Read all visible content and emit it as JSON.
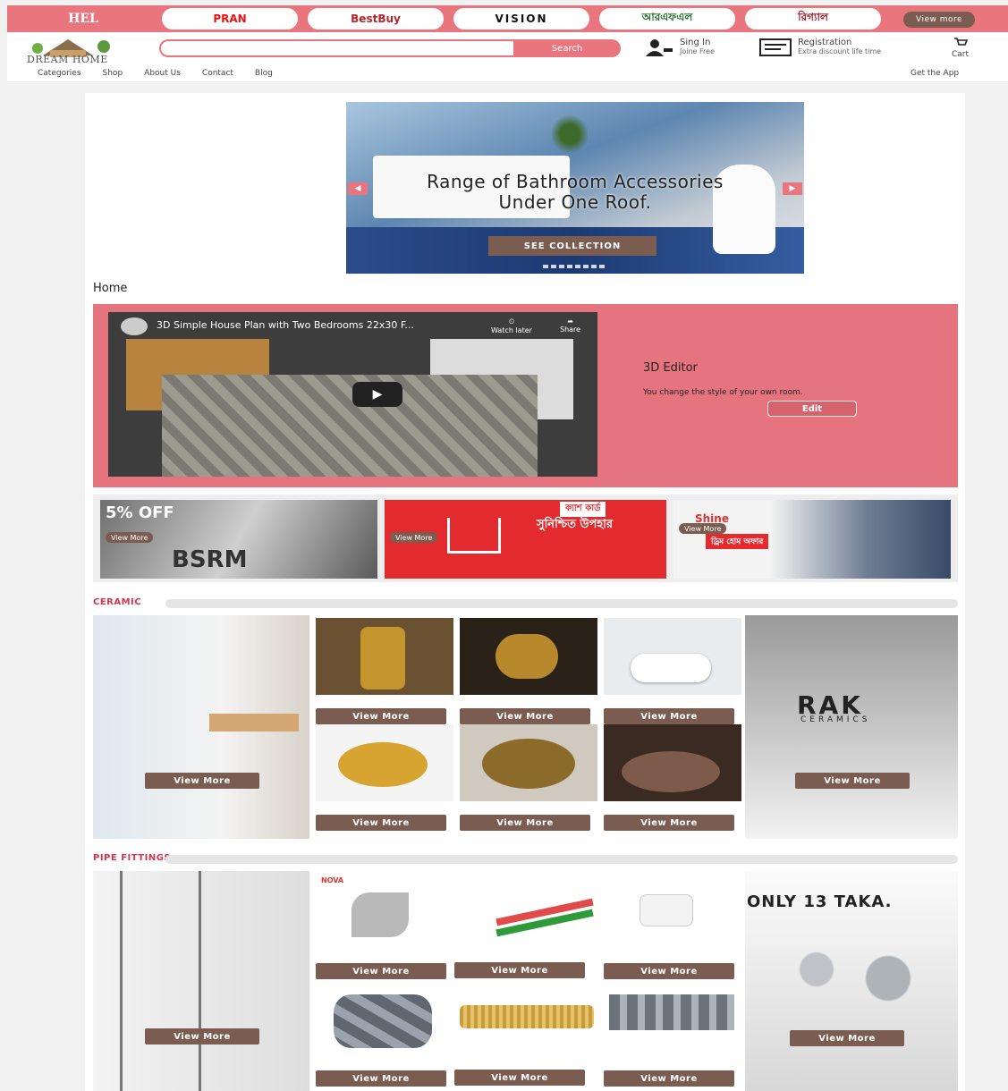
{
  "brands": {
    "home": "HEL",
    "pills": [
      "PRAN",
      "BestBuy",
      "VISION",
      "আরএফএল",
      "রিগ্যাল"
    ],
    "view_more": "View more"
  },
  "header": {
    "logo_text": "DREAM HOME",
    "search_placeholder": "",
    "search_button": "Search",
    "signin_title": "Sing In",
    "signin_sub": "Joine Free",
    "register_title": "Registration",
    "register_sub": "Extra discount life time",
    "cart": "Cart",
    "nav": [
      "Categories",
      "Shop",
      "About Us",
      "Contact",
      "Blog"
    ],
    "get_app": "Get the App"
  },
  "slider": {
    "line1": "Range of Bathroom Accessories",
    "line2": "Under One Roof.",
    "button": "SEE COLLECTION",
    "prev": "◀",
    "next": "▶"
  },
  "breadcrumb": "Home",
  "editor": {
    "video_title": "3D Simple House Plan with Two Bedrooms 22x30 F...",
    "watch_later": "Watch later",
    "share": "Share",
    "title": "3D Editor",
    "desc": "You change the style of your own room.",
    "edit": "Edit"
  },
  "banners": [
    {
      "headline": "5% OFF",
      "brand": "BSRM",
      "cta": "View More"
    },
    {
      "headline": "ক্যাশ কার্ড",
      "brand": "সুনিশ্চিত উপহার",
      "cta": "View More"
    },
    {
      "headline": "Shine",
      "brand": "ড্রিম হোম অফার",
      "cta": "View More"
    }
  ],
  "ceramic": {
    "heading": "CERAMIC",
    "tile_cta": "View More",
    "rak": "RAK",
    "rak_sub": "CERAMICS"
  },
  "pipe": {
    "heading": "PIPE FITTINGS",
    "tile_cta": "View More",
    "promo": "ONLY 13  TAKA.",
    "brand_tag": "NOVA"
  },
  "colors": {
    "accent": "#e9757f",
    "button": "#7a5c50",
    "section_heading": "#d8334a"
  }
}
